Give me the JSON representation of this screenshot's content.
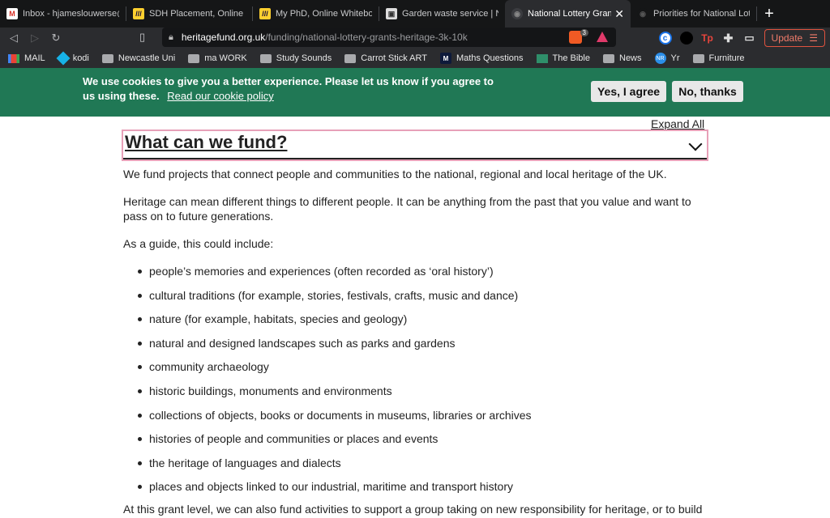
{
  "browser": {
    "tabs": [
      {
        "title": "Inbox - hjameslouwerse@gmail.com",
        "icon": "gmail-icon",
        "active": false
      },
      {
        "title": "SDH Placement, Online Whiteboard",
        "icon": "miro-icon",
        "active": false
      },
      {
        "title": "My PhD, Online Whiteboard",
        "icon": "miro-icon",
        "active": false
      },
      {
        "title": "Garden waste service | Newcastle",
        "icon": "council-icon",
        "active": false
      },
      {
        "title": "National Lottery Grants",
        "icon": "heritage-icon",
        "active": true
      },
      {
        "title": "Priorities for National Lottery",
        "icon": "heritage-icon",
        "active": false
      }
    ],
    "new_tab": "+",
    "url_host": "heritagefund.org.uk",
    "url_path": "/funding/national-lottery-grants-heritage-3k-10k",
    "brave_count": "3",
    "update_label": "Update",
    "bookmarks": [
      {
        "label": "MAIL",
        "icon": "gmail-icon"
      },
      {
        "label": "kodi",
        "icon": "kodi-icon"
      },
      {
        "label": "Newcastle Uni",
        "icon": "folder-icon"
      },
      {
        "label": "ma WORK",
        "icon": "folder-icon"
      },
      {
        "label": "Study Sounds",
        "icon": "folder-icon"
      },
      {
        "label": "Carrot Stick ART",
        "icon": "folder-icon"
      },
      {
        "label": "Maths Questions",
        "icon": "m-icon"
      },
      {
        "label": "The Bible",
        "icon": "image-icon"
      },
      {
        "label": "News",
        "icon": "folder-icon"
      },
      {
        "label": "Yr",
        "icon": "yr-icon"
      },
      {
        "label": "Furniture",
        "icon": "folder-icon"
      }
    ]
  },
  "cookie": {
    "text": "We use cookies to give you a better experience. Please let us know if you agree to us using these.",
    "link": "Read our cookie policy",
    "yes": "Yes, I agree",
    "no": "No, thanks",
    "bg_color": "#207855"
  },
  "page": {
    "expand_all": "Expand All",
    "section_title": "What can we fund?",
    "para1": "We fund projects that connect people and communities to the national, regional and local heritage of the UK.",
    "para2": "Heritage can mean different things to different people. It can be anything from the past that you value and want to pass on to future generations.",
    "para3": "As a guide, this could include:",
    "list": [
      "people’s memories and experiences (often recorded as ‘oral history’)",
      "cultural traditions (for example, stories, festivals, crafts, music and dance)",
      "nature (for example, habitats, species and geology)",
      "natural and designed landscapes such as parks and gardens",
      "community archaeology",
      "historic buildings, monuments and environments",
      "collections of objects, books or documents in museums, libraries or archives",
      "histories of people and communities or places and events",
      "the heritage of languages and dialects",
      "places and objects linked to our industrial, maritime and transport history"
    ],
    "final": "At this grant level, we can also fund activities to support a group taking on new responsibility for heritage, or to build"
  }
}
